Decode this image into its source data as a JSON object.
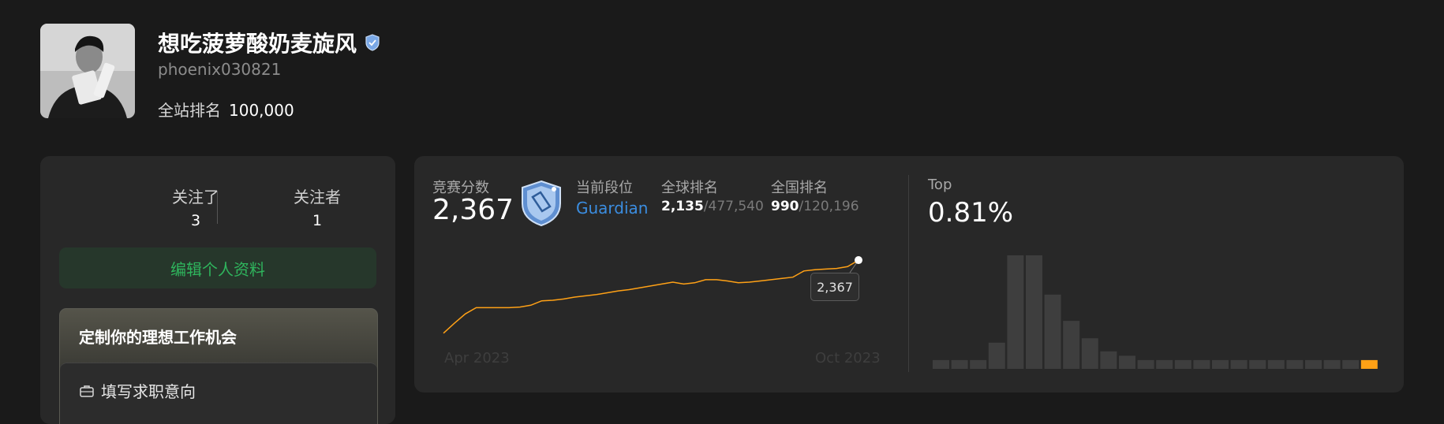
{
  "profile": {
    "name": "想吃菠萝酸奶麦旋风",
    "username": "phoenix030821",
    "site_rank_label": "全站排名",
    "site_rank_value": "100,000"
  },
  "follow": {
    "following_label": "关注了",
    "following_count": "3",
    "followers_label": "关注者",
    "followers_count": "1"
  },
  "edit_profile_label": "编辑个人资料",
  "job": {
    "title": "定制你的理想工作机会",
    "action_label": "填写求职意向"
  },
  "contest": {
    "score_label": "竞赛分数",
    "score": "2,367",
    "tier_label": "当前段位",
    "tier": "Guardian",
    "global_rank_label": "全球排名",
    "global_rank": "2,135",
    "global_total": "/477,540",
    "national_rank_label": "全国排名",
    "national_rank": "990",
    "national_total": "/120,196",
    "top_label": "Top",
    "top_value": "0.81%",
    "tooltip_value": "2,367"
  },
  "colors": {
    "accent_orange": "#ffa116",
    "edit_green": "#2fb55d",
    "tier_blue": "#3b8de0",
    "bar_gray": "#3e3e3e"
  },
  "chart_data": [
    {
      "type": "line",
      "title": "",
      "x_tick_labels": [
        "Apr 2023",
        "Oct 2023"
      ],
      "series": [
        {
          "values": [
            1780,
            1860,
            1935,
            1985,
            1985,
            1985,
            1985,
            1990,
            2005,
            2040,
            2045,
            2055,
            2070,
            2080,
            2090,
            2105,
            2120,
            2130,
            2145,
            2160,
            2175,
            2190,
            2175,
            2185,
            2210,
            2210,
            2200,
            2185,
            2190,
            2200,
            2210,
            2220,
            2230,
            2280,
            2290,
            2295,
            2300,
            2315,
            2367
          ]
        }
      ],
      "highlight_value": 2367,
      "ylim": [
        1760,
        2380
      ]
    },
    {
      "type": "bar",
      "title": "Top",
      "values": [
        2,
        2,
        2,
        6,
        26,
        26,
        17,
        11,
        7,
        4,
        3,
        2,
        2,
        2,
        2,
        2,
        2,
        2,
        2,
        2,
        2,
        2,
        2,
        2
      ],
      "highlight_index": 23,
      "ylim": [
        0,
        26
      ]
    }
  ]
}
